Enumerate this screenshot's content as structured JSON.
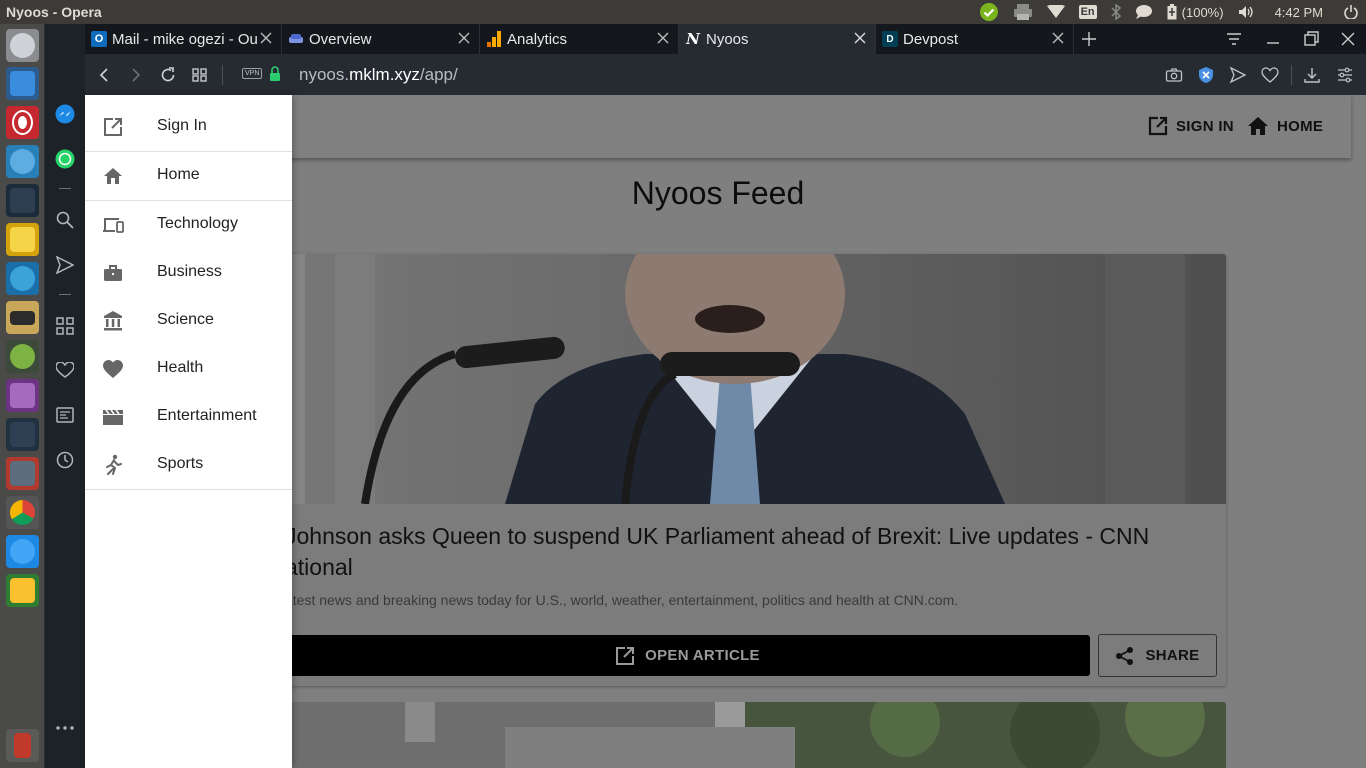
{
  "window": {
    "title": "Nyoos - Opera"
  },
  "system_tray": {
    "battery": "(100%)",
    "clock": "4:42 PM",
    "keyboard_layout": "En"
  },
  "tabs": [
    {
      "label": "Mail - mike ogezi - Ou",
      "icon": "outlook-icon",
      "color": "#0f6cbd"
    },
    {
      "label": "Overview",
      "icon": "car-icon",
      "color": "#4b6bd1"
    },
    {
      "label": "Analytics",
      "icon": "analytics-icon",
      "color": "#f9ab00"
    },
    {
      "label": "Nyoos",
      "icon": "nyoos-icon",
      "color": "#000000",
      "active": true
    },
    {
      "label": "Devpost",
      "icon": "devpost-icon",
      "color": "#003e54"
    }
  ],
  "address_bar": {
    "url_prefix": "nyoos.",
    "url_domain": "mklm.xyz",
    "url_path": "/app/",
    "vpn_label": "VPN"
  },
  "app_bar": {
    "sign_in": "SIGN IN",
    "home": "HOME"
  },
  "feed": {
    "title": "Nyoos Feed",
    "article": {
      "headline": "Johnson asks Queen to suspend UK Parliament ahead of Brexit: Live updates - CNN ational",
      "description": "atest news and breaking news today for U.S., world, weather, entertainment, politics and health at CNN.com.",
      "open_label": "OPEN ARTICLE",
      "share_label": "SHARE"
    }
  },
  "drawer": {
    "items": [
      {
        "label": "Sign In",
        "icon": "open-in-new-icon"
      },
      {
        "label": "Home",
        "icon": "home-icon"
      },
      {
        "label": "Technology",
        "icon": "devices-icon"
      },
      {
        "label": "Business",
        "icon": "briefcase-icon"
      },
      {
        "label": "Science",
        "icon": "bank-icon"
      },
      {
        "label": "Health",
        "icon": "heart-icon"
      },
      {
        "label": "Entertainment",
        "icon": "clapperboard-icon"
      },
      {
        "label": "Sports",
        "icon": "running-icon"
      }
    ]
  },
  "colors": {
    "launcher_bg": "#4a4a48",
    "opera_sidebar_bg": "#1d2229",
    "tabstrip_bg": "#14181d",
    "addressbar_bg": "#262b32",
    "scrim_page": "#7f7f7f",
    "drawer_bg": "#ffffff"
  }
}
